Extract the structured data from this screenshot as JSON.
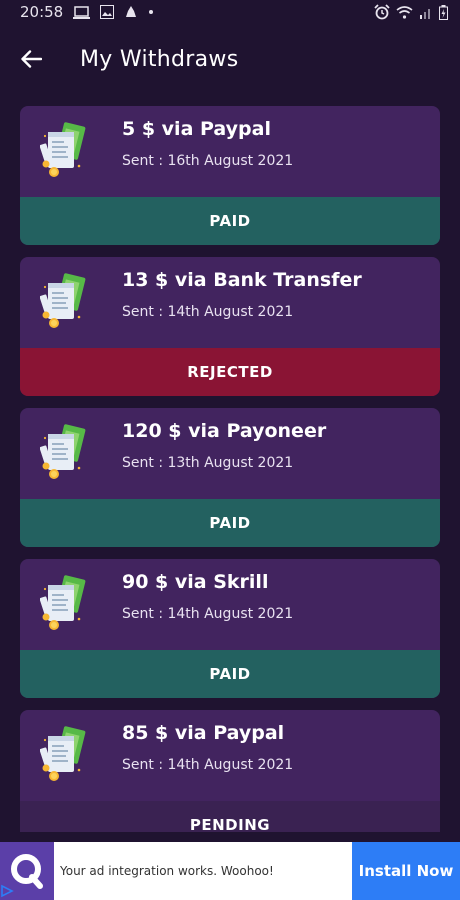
{
  "status_bar": {
    "time": "20:58"
  },
  "header": {
    "title": "My Withdraws"
  },
  "withdrawals": [
    {
      "title": "5 $ via Paypal",
      "date": "Sent : 16th August 2021",
      "status": "PAID",
      "status_color": "#236160"
    },
    {
      "title": "13 $ via Bank Transfer",
      "date": "Sent : 14th August 2021",
      "status": "REJECTED",
      "status_color": "#8a1434"
    },
    {
      "title": "120 $ via Payoneer",
      "date": "Sent : 13th August 2021",
      "status": "PAID",
      "status_color": "#236160"
    },
    {
      "title": "90 $ via Skrill",
      "date": "Sent : 14th August 2021",
      "status": "PAID",
      "status_color": "#236160"
    },
    {
      "title": "85 $ via Paypal",
      "date": "Sent : 14th August 2021",
      "status": "PENDING",
      "status_color": "#3a2252"
    }
  ],
  "ad": {
    "text": "Your ad integration works. Woohoo!",
    "cta": "Install Now"
  },
  "colors": {
    "background": "#1f1330",
    "card": "#42245f",
    "paid": "#236160",
    "rejected": "#8a1434",
    "pending": "#3a2252",
    "ad_button": "#2d7df6"
  }
}
